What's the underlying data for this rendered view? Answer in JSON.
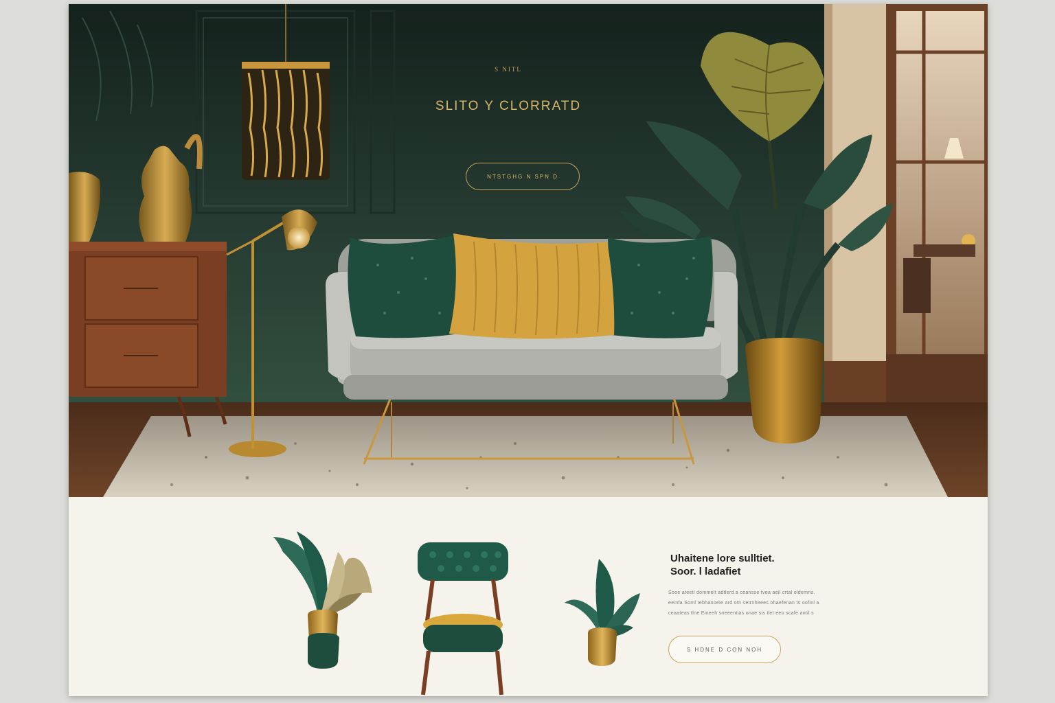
{
  "hero": {
    "eyebrow": "S NITL",
    "title": "SLITO Y CLORRATD",
    "cta_label": "NTSTGHG N SPN D"
  },
  "feature": {
    "title_line_1": "Uhaitene lore sulltiet.",
    "title_line_2": "Soor. l ladafiet",
    "body_lines": [
      "Sooe ateetl dommelt adtlerd a ceansse tvea aeil crtal oldemris.",
      "eeinfa Soml tebhanoeie ard otn setrnheees ohaefenan ts oofinl a",
      "ceaateas tlne Eineeh sneeentias onae sis tlet eeo scafe antil s"
    ],
    "cta_label": "S HDNE  D  CON   NOH"
  },
  "colors": {
    "wall": "#2f4a3e",
    "gold": "#c9a45c",
    "emerald": "#1f4d3d",
    "cream": "#f6f3ec"
  }
}
